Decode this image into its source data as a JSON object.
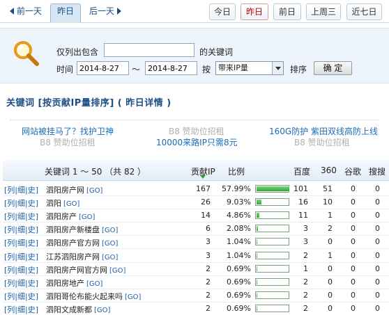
{
  "nav": {
    "prev_label": "前一天",
    "current_label": "昨日",
    "next_label": "后一天"
  },
  "range_tabs": [
    {
      "label": "今日",
      "active": false
    },
    {
      "label": "昨日",
      "active": true
    },
    {
      "label": "前日",
      "active": false
    },
    {
      "label": "上周三",
      "active": false
    },
    {
      "label": "近七日",
      "active": false
    }
  ],
  "filter": {
    "include_label": "仅列出包含",
    "keyword_value": "",
    "keyword_suffix": "的关键词",
    "time_label": "时间",
    "date_from": "2014-8-27",
    "tilde": "～",
    "date_to": "2014-8-27",
    "sort_by_label": "按",
    "sort_field": "带来IP量",
    "sort_label": "排序",
    "confirm_label": "确 定"
  },
  "page_title": "关键词 [按贡献IP量排序] ( 昨日详情 )",
  "ads": {
    "row1": [
      "网站被挂马了？找护卫神",
      "B8 赞助位招租",
      "160G防护 紫田双线高防上线"
    ],
    "row2": [
      "B8 赞助位招租",
      "10000来路IP只需8元",
      "B8 赞助位招租"
    ]
  },
  "table": {
    "headers": {
      "keyword": "关键词 1 ～ 50 （共 82 ）",
      "ip": "贡献IP",
      "ratio": "比例",
      "baidu": "百度",
      "s360": "360",
      "google": "谷歌",
      "sogou": "搜搜"
    },
    "op_labels": [
      "[列",
      "|细",
      "|史]"
    ],
    "go_label": "[GO]",
    "rows": [
      {
        "keyword": "泗阳房产网",
        "ip": "167",
        "ratio": "57.99%",
        "ratio_value": 57.99,
        "baidu": "101",
        "s360": "51",
        "google": "0",
        "sogou": "0"
      },
      {
        "keyword": "泗阳",
        "ip": "26",
        "ratio": "9.03%",
        "ratio_value": 9.03,
        "baidu": "16",
        "s360": "10",
        "google": "0",
        "sogou": "0"
      },
      {
        "keyword": "泗阳房产",
        "ip": "14",
        "ratio": "4.86%",
        "ratio_value": 4.86,
        "baidu": "11",
        "s360": "1",
        "google": "0",
        "sogou": "0"
      },
      {
        "keyword": "泗阳房产新楼盘",
        "ip": "6",
        "ratio": "2.08%",
        "ratio_value": 2.08,
        "baidu": "3",
        "s360": "2",
        "google": "0",
        "sogou": "0"
      },
      {
        "keyword": "泗阳房产官方网",
        "ip": "3",
        "ratio": "1.04%",
        "ratio_value": 1.04,
        "baidu": "3",
        "s360": "0",
        "google": "0",
        "sogou": "0"
      },
      {
        "keyword": "江苏泗阳房产网",
        "ip": "3",
        "ratio": "1.04%",
        "ratio_value": 1.04,
        "baidu": "2",
        "s360": "1",
        "google": "0",
        "sogou": "0"
      },
      {
        "keyword": "泗阳房产网官方网",
        "ip": "2",
        "ratio": "0.69%",
        "ratio_value": 0.69,
        "baidu": "1",
        "s360": "0",
        "google": "0",
        "sogou": "0"
      },
      {
        "keyword": "泗阳房地产",
        "ip": "2",
        "ratio": "0.69%",
        "ratio_value": 0.69,
        "baidu": "2",
        "s360": "0",
        "google": "0",
        "sogou": "0"
      },
      {
        "keyword": "泗阳哥伦布能火起来吗",
        "ip": "2",
        "ratio": "0.69%",
        "ratio_value": 0.69,
        "baidu": "2",
        "s360": "0",
        "google": "0",
        "sogou": "0"
      },
      {
        "keyword": "泗阳文成新都",
        "ip": "2",
        "ratio": "0.69%",
        "ratio_value": 0.69,
        "baidu": "2",
        "s360": "0",
        "google": "0",
        "sogou": "0"
      }
    ]
  },
  "colors": {
    "accent_blue": "#1a4f86",
    "active_tab_red": "#c00000",
    "bar_green": "#2fa62f"
  }
}
